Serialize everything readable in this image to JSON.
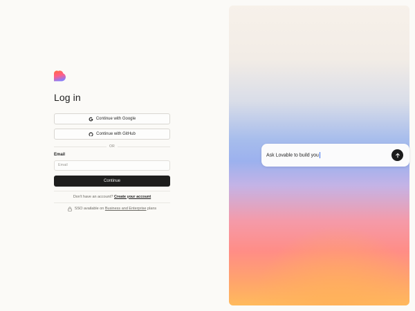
{
  "login": {
    "logo_icon": "lovable-heart-logo",
    "title": "Log in",
    "google_button": {
      "label": "Continue with Google",
      "icon": "google-icon"
    },
    "github_button": {
      "label": "Continue with GitHub",
      "icon": "github-icon"
    },
    "divider_text": "OR",
    "email_label": "Email",
    "email_placeholder": "Email",
    "email_value": "",
    "continue_label": "Continue",
    "signup_prompt": "Don't have an account?",
    "signup_link": "Create your account",
    "sso_prefix": "SSO available on",
    "sso_link": "Business and Enterprise",
    "sso_suffix": "plans",
    "sso_icon": "lock-icon"
  },
  "hero": {
    "prompt_text": "Ask Lovable to build you",
    "send_icon": "arrow-up-icon"
  },
  "colors": {
    "background": "#fbfaf7",
    "primary_button": "#1e1e1d",
    "logo_top": "#ff6a3d",
    "logo_bottom": "#8b7cf6"
  }
}
